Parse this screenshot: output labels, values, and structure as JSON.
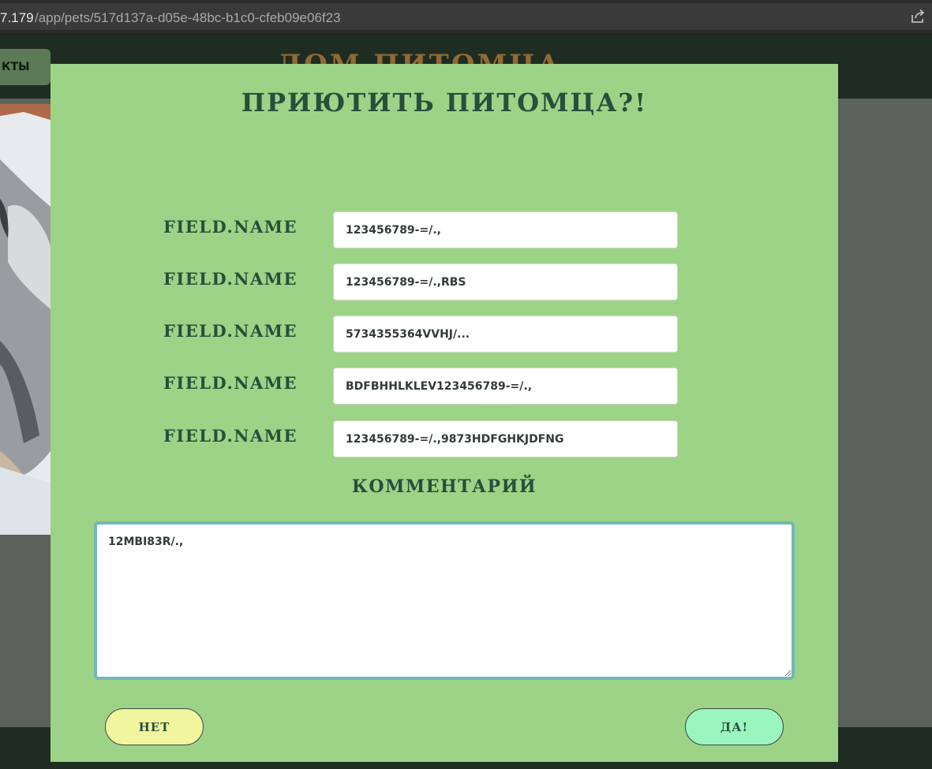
{
  "browser": {
    "url_host": "7.179",
    "url_path": "/app/pets/517d137a-d05e-48bc-b1c0-cfeb09e06f23",
    "share_icon": "share-icon"
  },
  "background_page": {
    "nav_button_label": "КТЫ",
    "site_title": "ДОМ ПИТОМЦА"
  },
  "modal": {
    "title": "ПРИЮТИТЬ ПИТОМЦА?!",
    "fields": [
      {
        "label": "FIELD.NAME",
        "value": "123456789-=/.,"
      },
      {
        "label": "FIELD.NAME",
        "value": "123456789-=/.,RBS"
      },
      {
        "label": "FIELD.NAME",
        "value": "5734355364VVHJ/..."
      },
      {
        "label": "FIELD.NAME",
        "value": "BDFBHHLKLEV123456789-=/.,"
      },
      {
        "label": "FIELD.NAME",
        "value": "123456789-=/.,9873HDFGHKJDFNG"
      }
    ],
    "comment_label": "КОММЕНТАРИЙ",
    "comment_value": "12MBI83R/.,",
    "no_button": "НЕТ",
    "yes_button": "ДА!"
  },
  "colors": {
    "modal_bg": "#9dd387",
    "accent_text": "#26503a",
    "no_button_bg": "#f2f59f",
    "yes_button_bg": "#9af5be",
    "textarea_border": "#72b7b4"
  }
}
